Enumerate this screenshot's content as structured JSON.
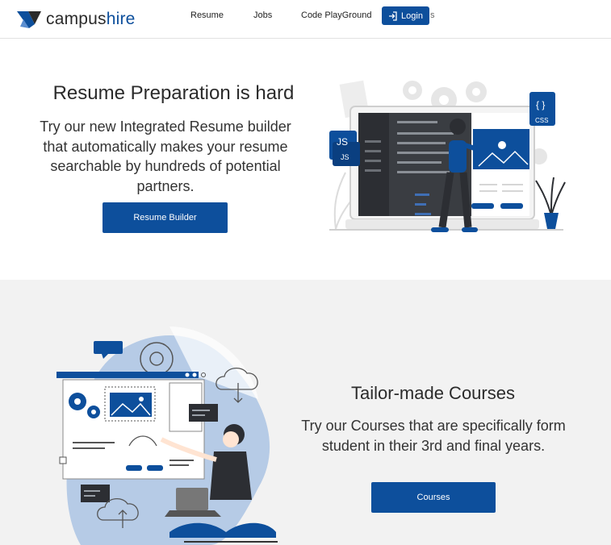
{
  "brand": {
    "name_part1": "campus",
    "name_part2": "hire",
    "accent_color": "#0d4f9c"
  },
  "nav": {
    "links": [
      "Resume",
      "Jobs",
      "Code PlayGround"
    ],
    "login_label": "Login",
    "trailing_text": "s"
  },
  "hero": {
    "title": "Resume Preparation is hard",
    "description": "Try our new Integrated Resume builder that automatically makes your resume searchable by hundreds of potential partners.",
    "cta_label": "Resume Builder",
    "illustration_badges": [
      "JS",
      "JS",
      "{ }",
      "CSS"
    ]
  },
  "courses": {
    "title": "Tailor-made Courses",
    "description": "Try our Courses that are specifically form student in their 3rd and final years.",
    "cta_label": "Courses"
  }
}
